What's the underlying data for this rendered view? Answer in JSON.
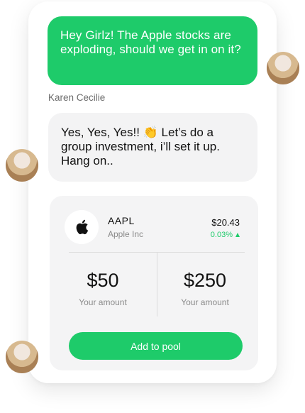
{
  "messages": [
    {
      "text": "Hey Girlz! The Apple stocks are exploding, should we get in on it?"
    },
    {
      "sender": "Karen Cecilie",
      "text": "Yes, Yes, Yes!! 👏 Let’s do a group investment, i’ll set it up. Hang on.."
    }
  ],
  "stock": {
    "ticker": "AAPL",
    "company": "Apple Inc",
    "price": "$20.43",
    "change": "0.03%",
    "icon": "apple-logo-icon",
    "change_icon": "triangle-up-icon",
    "accent": "#1ecb6a"
  },
  "amounts": [
    {
      "value": "$50",
      "label": "Your amount"
    },
    {
      "value": "$250",
      "label": "Your amount"
    }
  ],
  "action": {
    "label": "Add to pool"
  }
}
